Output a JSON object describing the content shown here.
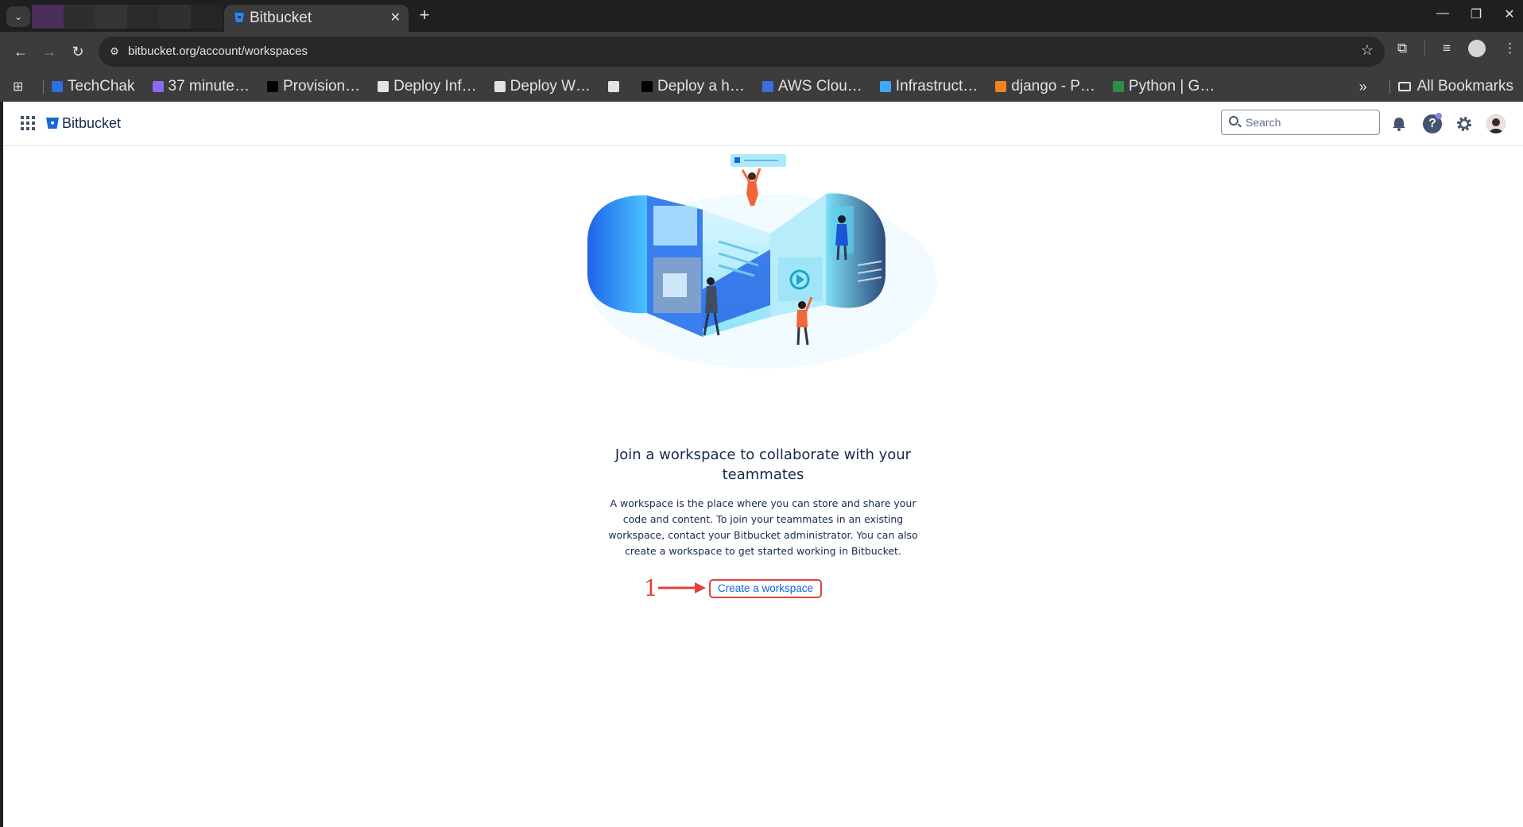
{
  "browser": {
    "tab": {
      "title": "Bitbucket",
      "close": "✕"
    },
    "new_tab": "+",
    "window_controls": [
      "—",
      "❐",
      "✕"
    ],
    "url": "bitbucket.org/account/workspaces",
    "bookmarks": [
      {
        "label": "TechChak",
        "icon": "techchak-icon",
        "color": "#2f6fe4"
      },
      {
        "label": "37 minute…",
        "icon": "medium-icon",
        "color": "#8d6bf0"
      },
      {
        "label": "Provision…",
        "icon": "dev-icon",
        "color": "#000000"
      },
      {
        "label": "Deploy Inf…",
        "icon": "globe-icon",
        "color": "#e3e3e3"
      },
      {
        "label": "Deploy W…",
        "icon": "graduation-icon",
        "color": "#e3e3e3"
      },
      {
        "label": "",
        "icon": "globe-icon",
        "color": "#e3e3e3"
      },
      {
        "label": "Deploy a h…",
        "icon": "medium-icon",
        "color": "#000000"
      },
      {
        "label": "AWS Clou…",
        "icon": "aws-icon",
        "color": "#3b6fe0"
      },
      {
        "label": "Infrastruct…",
        "icon": "chart-icon",
        "color": "#3fa9f5"
      },
      {
        "label": "django - P…",
        "icon": "stackoverflow-icon",
        "color": "#f48024"
      },
      {
        "label": "Python | G…",
        "icon": "gfg-icon",
        "color": "#2f8d46"
      }
    ],
    "bookmarks_more": "»",
    "all_bookmarks": "All Bookmarks"
  },
  "bitbucket": {
    "product_name": "Bitbucket",
    "search_placeholder": "Search",
    "help_label": "?",
    "brand_color": "#0c66e4"
  },
  "content": {
    "heading": "Join a workspace to collaborate with your teammates",
    "description": "A workspace is the place where you can store and share your code and content. To join your teammates in an existing workspace, contact your Bitbucket administrator. You can also create a workspace to get started working in Bitbucket.",
    "create_link": "Create a workspace"
  },
  "annotation": {
    "number": "1",
    "color": "#e0413e"
  }
}
